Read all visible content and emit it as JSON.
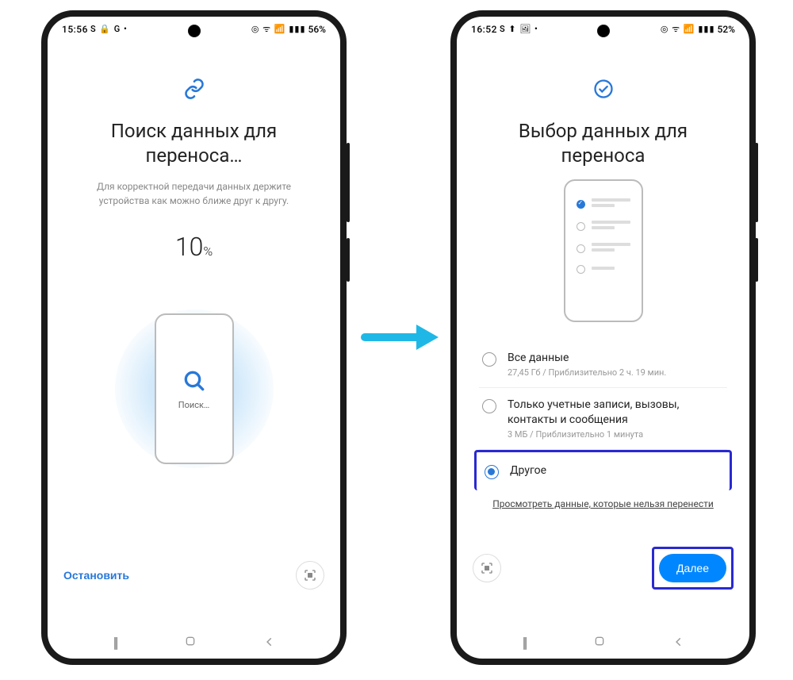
{
  "left": {
    "status": {
      "time": "15:56",
      "left_icons": "S 🔒 G •",
      "right_icons": "◎ ᯤ 📶 ▮▮▮",
      "battery": "56%"
    },
    "title": "Поиск данных для переноса…",
    "subtitle": "Для корректной передачи данных держите устройства как можно ближе друг к другу.",
    "progress_value": "10",
    "progress_unit": "%",
    "search_label": "Поиск…",
    "stop_label": "Остановить"
  },
  "right": {
    "status": {
      "time": "16:52",
      "left_icons": "S ⬆ 🖼 •",
      "right_icons": "◎ ᯤ 📶 ▮▮▮",
      "battery": "52%"
    },
    "title": "Выбор данных для переноса",
    "options": [
      {
        "title": "Все данные",
        "sub": "27,45 Гб / Приблизительно 2 ч. 19 мин.",
        "selected": false
      },
      {
        "title": "Только учетные записи, вызовы, контакты и сообщения",
        "sub": "3 МБ / Приблизительно 1 минута",
        "selected": false
      },
      {
        "title": "Другое",
        "sub": "",
        "selected": true
      }
    ],
    "view_link": "Просмотреть данные, которые нельзя перенести",
    "next_label": "Далее"
  }
}
